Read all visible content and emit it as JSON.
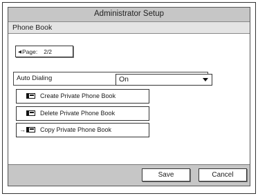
{
  "window": {
    "title": "Administrator Setup"
  },
  "header": {
    "section": "Phone Book"
  },
  "pager": {
    "label": "Page:",
    "value": "2/2"
  },
  "auto_dialing": {
    "label": "Auto Dialing",
    "value": "On"
  },
  "actions": [
    {
      "label": "Create Private Phone Book",
      "icon": "phonebook-icon"
    },
    {
      "label": "Delete Private Phone Book",
      "icon": "phonebook-icon"
    },
    {
      "label": "Copy Private Phone Book",
      "icon": "copy-phonebook-icon"
    }
  ],
  "footer": {
    "save_label": "Save",
    "cancel_label": "Cancel"
  }
}
